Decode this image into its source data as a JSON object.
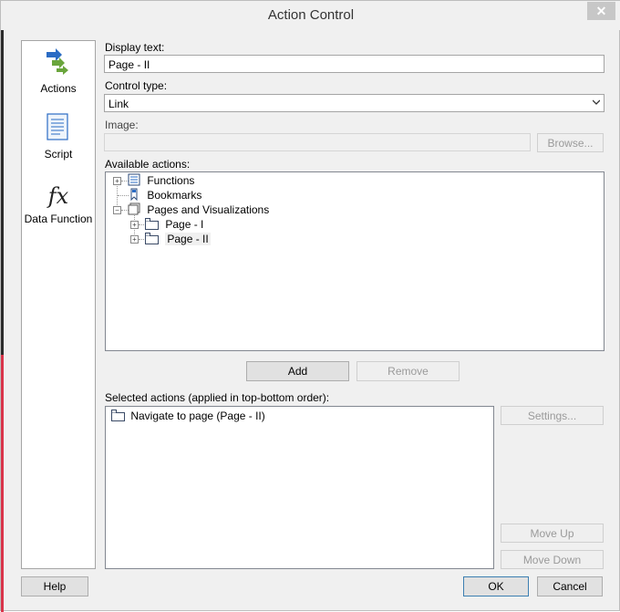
{
  "window": {
    "title": "Action Control",
    "close_symbol": "✕"
  },
  "sidebar": {
    "items": [
      {
        "label": "Actions",
        "icon": "actions-arrows-icon"
      },
      {
        "label": "Script",
        "icon": "script-document-icon"
      },
      {
        "label": "Data Function",
        "icon": "function-fx-icon",
        "glyph": "fx"
      }
    ]
  },
  "form": {
    "display_text_label": "Display text:",
    "display_text_value": "Page - II",
    "control_type_label": "Control type:",
    "control_type_value": "Link",
    "image_label": "Image:",
    "image_value": "",
    "browse_button": "Browse...",
    "available_actions_label": "Available actions:",
    "tree": [
      {
        "label": "Functions"
      },
      {
        "label": "Bookmarks"
      },
      {
        "label": "Pages and Visualizations"
      },
      {
        "label": "Page - I"
      },
      {
        "label": "Page - II"
      }
    ],
    "add_button": "Add",
    "remove_button": "Remove",
    "selected_actions_label": "Selected actions (applied in top-bottom order):",
    "selected_actions": [
      {
        "label": "Navigate to page (Page - II)"
      }
    ],
    "settings_button": "Settings...",
    "move_up_button": "Move Up",
    "move_down_button": "Move Down"
  },
  "footer": {
    "help_button": "Help",
    "ok_button": "OK",
    "cancel_button": "Cancel"
  },
  "colors": {
    "accent_blue": "#2b6cc4",
    "accent_green": "#6aa53c",
    "red_strip": "#d9344a"
  }
}
